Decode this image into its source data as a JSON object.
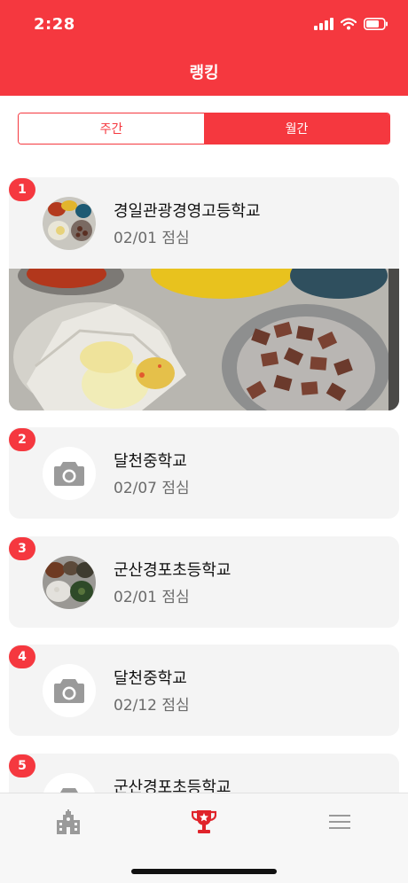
{
  "status_bar": {
    "time": "2:28"
  },
  "header": {
    "title": "랭킹"
  },
  "segmented": {
    "weekly_label": "주간",
    "monthly_label": "월간",
    "selected": "monthly"
  },
  "rankings": [
    {
      "rank": "1",
      "school": "경일관광경영고등학교",
      "meal": "02/01 점심",
      "thumbnail": "meal-photo"
    },
    {
      "rank": "2",
      "school": "달천중학교",
      "meal": "02/07 점심",
      "thumbnail": "camera-icon"
    },
    {
      "rank": "3",
      "school": "군산경포초등학교",
      "meal": "02/01 점심",
      "thumbnail": "meal-photo"
    },
    {
      "rank": "4",
      "school": "달천중학교",
      "meal": "02/12 점심",
      "thumbnail": "camera-icon"
    },
    {
      "rank": "5",
      "school": "군산경포초등학교",
      "meal": "",
      "thumbnail": "camera-icon"
    }
  ],
  "tabbar": {
    "items": [
      {
        "icon": "school-icon",
        "active": false
      },
      {
        "icon": "trophy-icon",
        "active": true
      },
      {
        "icon": "menu-icon",
        "active": false
      }
    ]
  },
  "colors": {
    "accent": "#f5383f",
    "card_bg": "#f4f4f4",
    "muted_text": "#6b6b6b",
    "icon_gray": "#9a9a9a"
  }
}
